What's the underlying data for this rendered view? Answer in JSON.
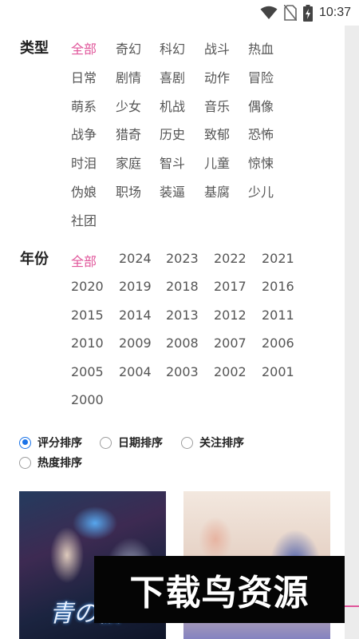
{
  "status_bar": {
    "time": "10:37",
    "icons": [
      "wifi-icon",
      "no-sim-icon",
      "battery-charging-icon"
    ]
  },
  "genre_filter": {
    "label": "类型",
    "options": [
      "全部",
      "奇幻",
      "科幻",
      "战斗",
      "热血",
      "日常",
      "剧情",
      "喜剧",
      "动作",
      "冒险",
      "萌系",
      "少女",
      "机战",
      "音乐",
      "偶像",
      "战争",
      "猎奇",
      "历史",
      "致郁",
      "恐怖",
      "时泪",
      "家庭",
      "智斗",
      "儿童",
      "惊悚",
      "伪娘",
      "职场",
      "装逼",
      "基腐",
      "少儿",
      "社团"
    ],
    "selected": "全部"
  },
  "year_filter": {
    "label": "年份",
    "options": [
      "全部",
      "2024",
      "2023",
      "2022",
      "2021",
      "2020",
      "2019",
      "2018",
      "2017",
      "2016",
      "2015",
      "2014",
      "2013",
      "2012",
      "2011",
      "2010",
      "2009",
      "2008",
      "2007",
      "2006",
      "2005",
      "2004",
      "2003",
      "2002",
      "2001",
      "2000"
    ],
    "selected": "全部"
  },
  "sort": {
    "options": [
      "评分排序",
      "日期排序",
      "关注排序",
      "热度排序"
    ],
    "selected": "评分排序"
  },
  "covers": {
    "left_title": "青の祓"
  },
  "watermark": "下载鸟资源",
  "colors": {
    "accent": "#e0559a",
    "radio_selected": "#1a73e8"
  }
}
